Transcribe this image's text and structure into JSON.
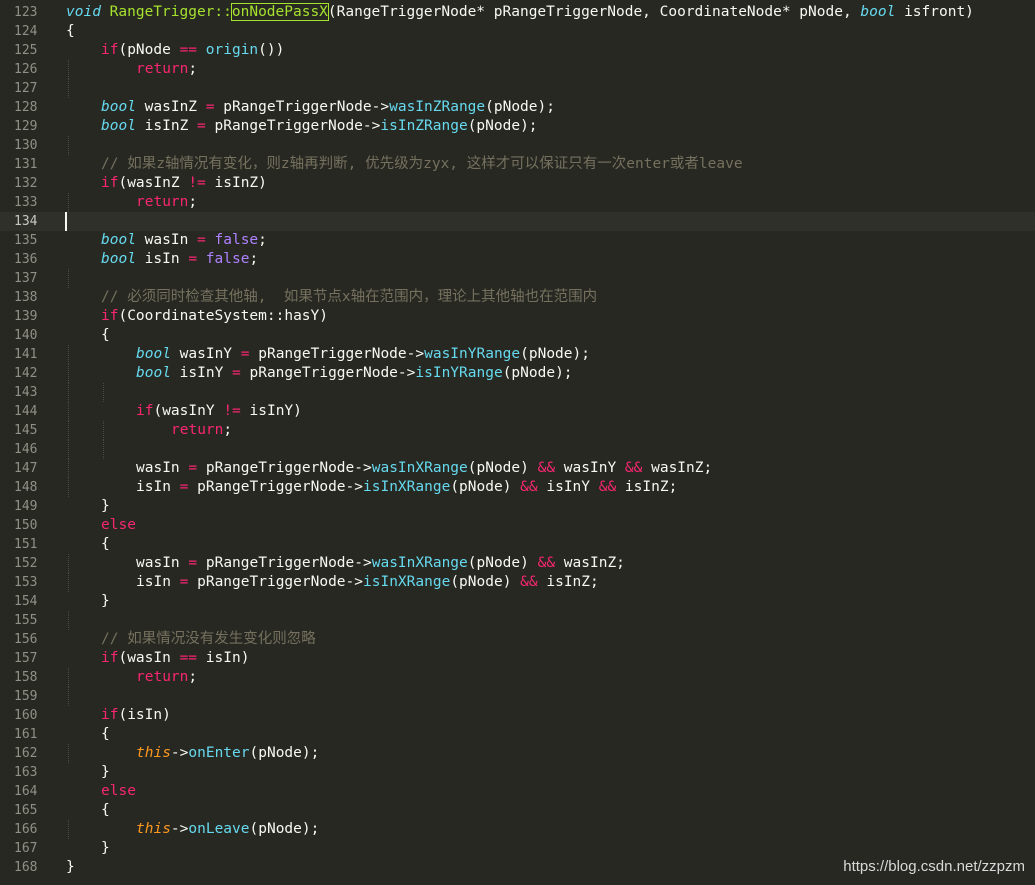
{
  "editor": {
    "theme_colors": {
      "background": "#272822",
      "keyword": "#f92672",
      "type": "#66d9ef",
      "function": "#a6e22e",
      "comment": "#75715e",
      "boolean": "#ae81ff",
      "this": "#fd971f",
      "text": "#f8f8f2"
    },
    "cursor_line": 134,
    "lines": [
      {
        "num": "123",
        "indent": 0,
        "tokens": [
          [
            "t",
            "void"
          ],
          [
            "n",
            " "
          ],
          [
            "f",
            "RangeTrigger::"
          ],
          [
            "fhl",
            "onNodePassX"
          ],
          [
            "n",
            "(RangeTriggerNode* pRangeTriggerNode, CoordinateNode* pNode, "
          ],
          [
            "t",
            "bool"
          ],
          [
            "n",
            " isfront)"
          ]
        ]
      },
      {
        "num": "124",
        "indent": 0,
        "tokens": [
          [
            "n",
            "{"
          ]
        ]
      },
      {
        "num": "125",
        "indent": 1,
        "tokens": [
          [
            "k",
            "if"
          ],
          [
            "n",
            "(pNode "
          ],
          [
            "o",
            "=="
          ],
          [
            "n",
            " "
          ],
          [
            "fc",
            "origin"
          ],
          [
            "n",
            "())"
          ]
        ]
      },
      {
        "num": "126",
        "indent": 2,
        "tokens": [
          [
            "k",
            "return"
          ],
          [
            "n",
            ";"
          ]
        ]
      },
      {
        "num": "127",
        "indent": 1,
        "tokens": []
      },
      {
        "num": "128",
        "indent": 1,
        "tokens": [
          [
            "t",
            "bool"
          ],
          [
            "n",
            " wasInZ "
          ],
          [
            "o",
            "="
          ],
          [
            "n",
            " pRangeTriggerNode->"
          ],
          [
            "fc",
            "wasInZRange"
          ],
          [
            "n",
            "(pNode);"
          ]
        ]
      },
      {
        "num": "129",
        "indent": 1,
        "tokens": [
          [
            "t",
            "bool"
          ],
          [
            "n",
            " isInZ "
          ],
          [
            "o",
            "="
          ],
          [
            "n",
            " pRangeTriggerNode->"
          ],
          [
            "fc",
            "isInZRange"
          ],
          [
            "n",
            "(pNode);"
          ]
        ]
      },
      {
        "num": "130",
        "indent": 1,
        "tokens": []
      },
      {
        "num": "131",
        "indent": 1,
        "tokens": [
          [
            "c",
            "// 如果z轴情况有变化，则z轴再判断, 优先级为zyx, 这样才可以保证只有一次enter或者leave"
          ]
        ]
      },
      {
        "num": "132",
        "indent": 1,
        "tokens": [
          [
            "k",
            "if"
          ],
          [
            "n",
            "(wasInZ "
          ],
          [
            "o",
            "!="
          ],
          [
            "n",
            " isInZ)"
          ]
        ]
      },
      {
        "num": "133",
        "indent": 2,
        "tokens": [
          [
            "k",
            "return"
          ],
          [
            "n",
            ";"
          ]
        ]
      },
      {
        "num": "134",
        "indent": 0,
        "tokens": []
      },
      {
        "num": "135",
        "indent": 1,
        "tokens": [
          [
            "t",
            "bool"
          ],
          [
            "n",
            " wasIn "
          ],
          [
            "o",
            "="
          ],
          [
            "n",
            " "
          ],
          [
            "b",
            "false"
          ],
          [
            "n",
            ";"
          ]
        ]
      },
      {
        "num": "136",
        "indent": 1,
        "tokens": [
          [
            "t",
            "bool"
          ],
          [
            "n",
            " isIn "
          ],
          [
            "o",
            "="
          ],
          [
            "n",
            " "
          ],
          [
            "b",
            "false"
          ],
          [
            "n",
            ";"
          ]
        ]
      },
      {
        "num": "137",
        "indent": 1,
        "tokens": []
      },
      {
        "num": "138",
        "indent": 1,
        "tokens": [
          [
            "c",
            "// 必须同时检查其他轴,  如果节点x轴在范围内，理论上其他轴也在范围内"
          ]
        ]
      },
      {
        "num": "139",
        "indent": 1,
        "tokens": [
          [
            "k",
            "if"
          ],
          [
            "n",
            "(CoordinateSystem::hasY)"
          ]
        ]
      },
      {
        "num": "140",
        "indent": 1,
        "tokens": [
          [
            "n",
            "{"
          ]
        ]
      },
      {
        "num": "141",
        "indent": 2,
        "tokens": [
          [
            "t",
            "bool"
          ],
          [
            "n",
            " wasInY "
          ],
          [
            "o",
            "="
          ],
          [
            "n",
            " pRangeTriggerNode->"
          ],
          [
            "fc",
            "wasInYRange"
          ],
          [
            "n",
            "(pNode);"
          ]
        ]
      },
      {
        "num": "142",
        "indent": 2,
        "tokens": [
          [
            "t",
            "bool"
          ],
          [
            "n",
            " isInY "
          ],
          [
            "o",
            "="
          ],
          [
            "n",
            " pRangeTriggerNode->"
          ],
          [
            "fc",
            "isInYRange"
          ],
          [
            "n",
            "(pNode);"
          ]
        ]
      },
      {
        "num": "143",
        "indent": 2,
        "tokens": []
      },
      {
        "num": "144",
        "indent": 2,
        "tokens": [
          [
            "k",
            "if"
          ],
          [
            "n",
            "(wasInY "
          ],
          [
            "o",
            "!="
          ],
          [
            "n",
            " isInY)"
          ]
        ]
      },
      {
        "num": "145",
        "indent": 3,
        "tokens": [
          [
            "k",
            "return"
          ],
          [
            "n",
            ";"
          ]
        ]
      },
      {
        "num": "146",
        "indent": 2,
        "tokens": []
      },
      {
        "num": "147",
        "indent": 2,
        "tokens": [
          [
            "n",
            "wasIn "
          ],
          [
            "o",
            "="
          ],
          [
            "n",
            " pRangeTriggerNode->"
          ],
          [
            "fc",
            "wasInXRange"
          ],
          [
            "n",
            "(pNode) "
          ],
          [
            "o",
            "&&"
          ],
          [
            "n",
            " wasInY "
          ],
          [
            "o",
            "&&"
          ],
          [
            "n",
            " wasInZ;"
          ]
        ]
      },
      {
        "num": "148",
        "indent": 2,
        "tokens": [
          [
            "n",
            "isIn "
          ],
          [
            "o",
            "="
          ],
          [
            "n",
            " pRangeTriggerNode->"
          ],
          [
            "fc",
            "isInXRange"
          ],
          [
            "n",
            "(pNode) "
          ],
          [
            "o",
            "&&"
          ],
          [
            "n",
            " isInY "
          ],
          [
            "o",
            "&&"
          ],
          [
            "n",
            " isInZ;"
          ]
        ]
      },
      {
        "num": "149",
        "indent": 1,
        "tokens": [
          [
            "n",
            "}"
          ]
        ]
      },
      {
        "num": "150",
        "indent": 1,
        "tokens": [
          [
            "k",
            "else"
          ]
        ]
      },
      {
        "num": "151",
        "indent": 1,
        "tokens": [
          [
            "n",
            "{"
          ]
        ]
      },
      {
        "num": "152",
        "indent": 2,
        "tokens": [
          [
            "n",
            "wasIn "
          ],
          [
            "o",
            "="
          ],
          [
            "n",
            " pRangeTriggerNode->"
          ],
          [
            "fc",
            "wasInXRange"
          ],
          [
            "n",
            "(pNode) "
          ],
          [
            "o",
            "&&"
          ],
          [
            "n",
            " wasInZ;"
          ]
        ]
      },
      {
        "num": "153",
        "indent": 2,
        "tokens": [
          [
            "n",
            "isIn "
          ],
          [
            "o",
            "="
          ],
          [
            "n",
            " pRangeTriggerNode->"
          ],
          [
            "fc",
            "isInXRange"
          ],
          [
            "n",
            "(pNode) "
          ],
          [
            "o",
            "&&"
          ],
          [
            "n",
            " isInZ;"
          ]
        ]
      },
      {
        "num": "154",
        "indent": 1,
        "tokens": [
          [
            "n",
            "}"
          ]
        ]
      },
      {
        "num": "155",
        "indent": 1,
        "tokens": []
      },
      {
        "num": "156",
        "indent": 1,
        "tokens": [
          [
            "c",
            "// 如果情况没有发生变化则忽略"
          ]
        ]
      },
      {
        "num": "157",
        "indent": 1,
        "tokens": [
          [
            "k",
            "if"
          ],
          [
            "n",
            "(wasIn "
          ],
          [
            "o",
            "=="
          ],
          [
            "n",
            " isIn)"
          ]
        ]
      },
      {
        "num": "158",
        "indent": 2,
        "tokens": [
          [
            "k",
            "return"
          ],
          [
            "n",
            ";"
          ]
        ]
      },
      {
        "num": "159",
        "indent": 1,
        "tokens": []
      },
      {
        "num": "160",
        "indent": 1,
        "tokens": [
          [
            "k",
            "if"
          ],
          [
            "n",
            "(isIn)"
          ]
        ]
      },
      {
        "num": "161",
        "indent": 1,
        "tokens": [
          [
            "n",
            "{"
          ]
        ]
      },
      {
        "num": "162",
        "indent": 2,
        "tokens": [
          [
            "th",
            "this"
          ],
          [
            "n",
            "->"
          ],
          [
            "fc",
            "onEnter"
          ],
          [
            "n",
            "(pNode);"
          ]
        ]
      },
      {
        "num": "163",
        "indent": 1,
        "tokens": [
          [
            "n",
            "}"
          ]
        ]
      },
      {
        "num": "164",
        "indent": 1,
        "tokens": [
          [
            "k",
            "else"
          ]
        ]
      },
      {
        "num": "165",
        "indent": 1,
        "tokens": [
          [
            "n",
            "{"
          ]
        ]
      },
      {
        "num": "166",
        "indent": 2,
        "tokens": [
          [
            "th",
            "this"
          ],
          [
            "n",
            "->"
          ],
          [
            "fc",
            "onLeave"
          ],
          [
            "n",
            "(pNode);"
          ]
        ]
      },
      {
        "num": "167",
        "indent": 1,
        "tokens": [
          [
            "n",
            "}"
          ]
        ]
      },
      {
        "num": "168",
        "indent": 0,
        "tokens": [
          [
            "n",
            "}"
          ]
        ]
      }
    ]
  },
  "watermark": "https://blog.csdn.net/zzpzm"
}
